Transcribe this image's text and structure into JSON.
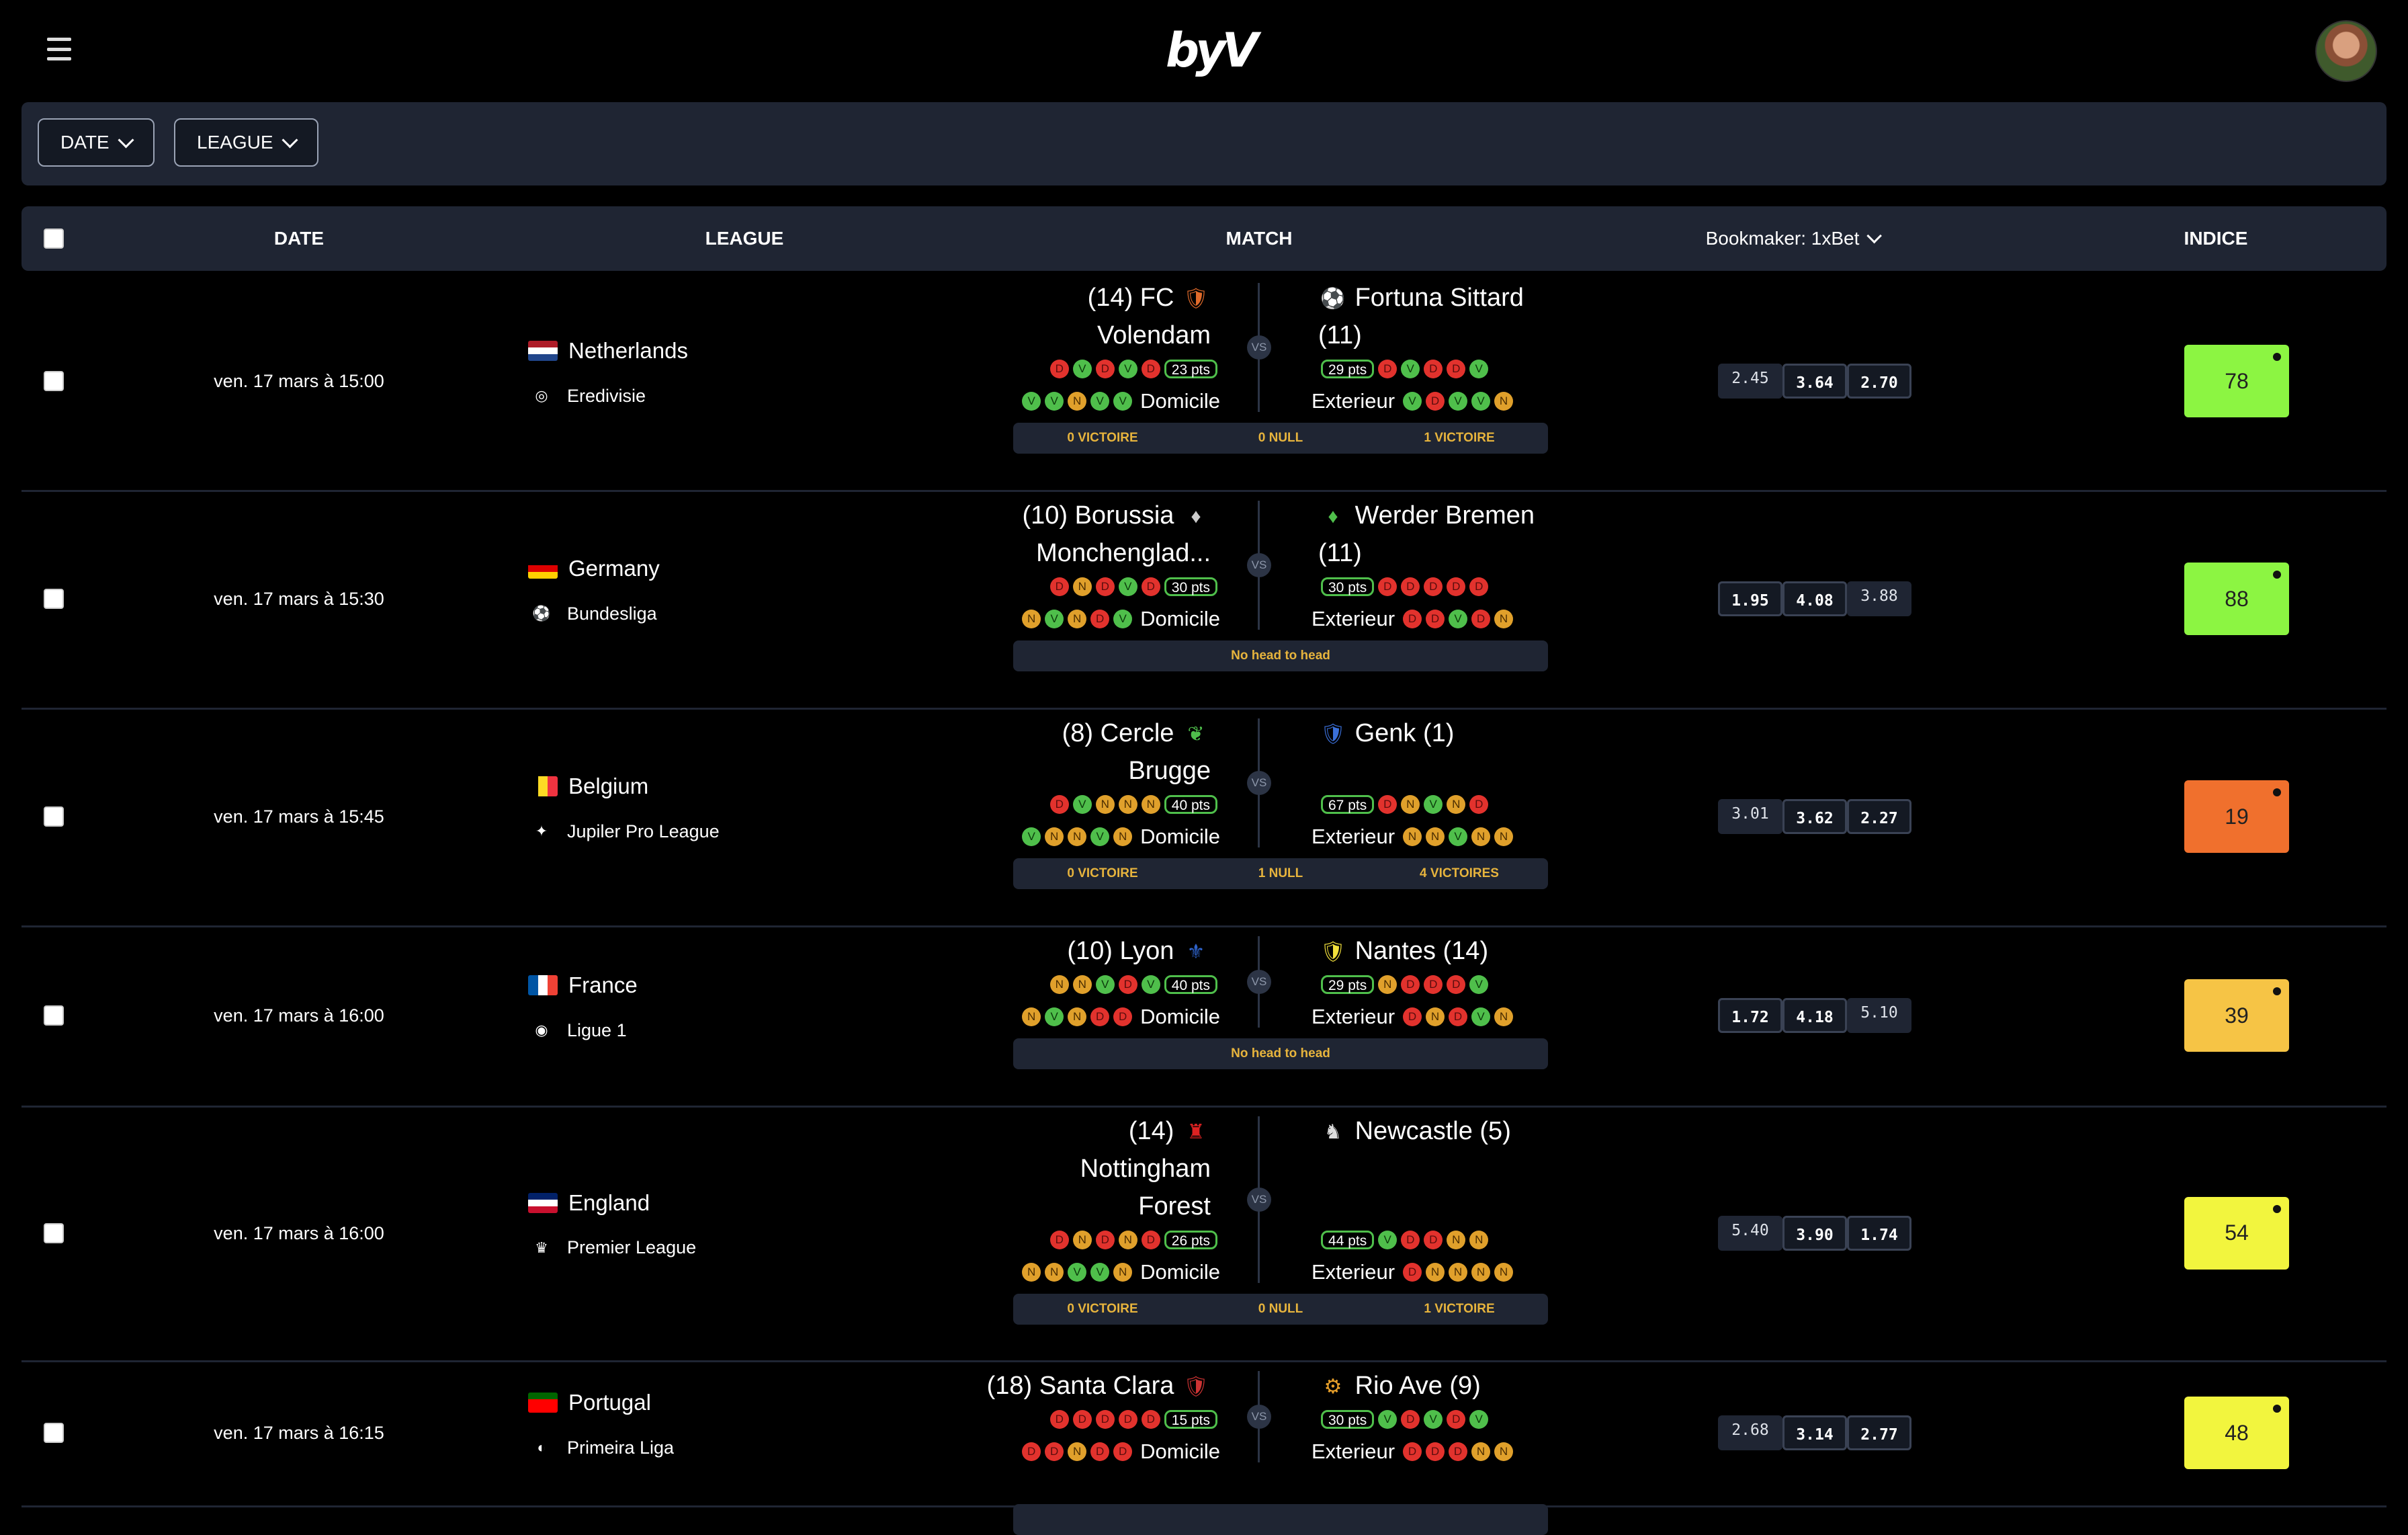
{
  "header": {
    "logo_text": "byV",
    "menu_icon": "hamburger-menu-icon",
    "avatar": "user-avatar"
  },
  "filters": {
    "date_label": "DATE",
    "league_label": "LEAGUE"
  },
  "table": {
    "headers": {
      "date": "DATE",
      "league": "LEAGUE",
      "match": "MATCH",
      "bookmaker": "Bookmaker: 1xBet",
      "indice": "INDICE"
    },
    "vs_label": "VS",
    "home_label": "Domicile",
    "away_label": "Exterieur",
    "rows": [
      {
        "date": "ven. 17 mars à 15:00",
        "country": "Netherlands",
        "league": "Eredivisie",
        "home_name_1": "(14) FC",
        "home_name_2": "Volendam",
        "home_name_3": "",
        "away_name_1": "Fortuna Sittard",
        "away_name_2": "(11)",
        "home_form_1": [
          "D",
          "V",
          "D",
          "V",
          "D"
        ],
        "home_pts": "23 pts",
        "home_form_2": [
          "V",
          "V",
          "N",
          "V",
          "V"
        ],
        "away_pts": "29 pts",
        "away_form_1": [
          "D",
          "V",
          "D",
          "D",
          "V"
        ],
        "away_form_2": [
          "V",
          "D",
          "V",
          "V",
          "N"
        ],
        "h2h": [
          "0 VICTOIRE",
          "0 NULL",
          "1 VICTOIRE"
        ],
        "odds": [
          "2.45",
          "3.64",
          "2.70"
        ],
        "indice": "78",
        "indice_color": "#8cf542"
      },
      {
        "date": "ven. 17 mars à 15:30",
        "country": "Germany",
        "league": "Bundesliga",
        "home_name_1": "(10) Borussia",
        "home_name_2": "Monchenglad...",
        "home_name_3": "",
        "away_name_1": "Werder Bremen",
        "away_name_2": "(11)",
        "home_form_1": [
          "D",
          "N",
          "D",
          "V",
          "D"
        ],
        "home_pts": "30 pts",
        "home_form_2": [
          "N",
          "V",
          "N",
          "D",
          "V"
        ],
        "away_pts": "30 pts",
        "away_form_1": [
          "D",
          "D",
          "D",
          "D",
          "D"
        ],
        "away_form_2": [
          "D",
          "D",
          "V",
          "D",
          "N"
        ],
        "h2h": [
          "No head to head"
        ],
        "odds": [
          "1.95",
          "4.08",
          "3.88"
        ],
        "indice": "88",
        "indice_color": "#8cf542"
      },
      {
        "date": "ven. 17 mars à 15:45",
        "country": "Belgium",
        "league": "Jupiler Pro League",
        "home_name_1": "(8) Cercle",
        "home_name_2": "Brugge",
        "home_name_3": "",
        "away_name_1": "Genk (1)",
        "away_name_2": "",
        "home_form_1": [
          "D",
          "V",
          "N",
          "N",
          "N"
        ],
        "home_pts": "40 pts",
        "home_form_2": [
          "V",
          "N",
          "N",
          "V",
          "N"
        ],
        "away_pts": "67 pts",
        "away_form_1": [
          "D",
          "N",
          "V",
          "N",
          "D"
        ],
        "away_form_2": [
          "N",
          "N",
          "V",
          "N",
          "N"
        ],
        "h2h": [
          "0 VICTOIRE",
          "1 NULL",
          "4 VICTOIRES"
        ],
        "odds": [
          "3.01",
          "3.62",
          "2.27"
        ],
        "indice": "19",
        "indice_color": "#f0702d"
      },
      {
        "date": "ven. 17 mars à 16:00",
        "country": "France",
        "league": "Ligue 1",
        "home_name_1": "(10) Lyon",
        "home_name_2": "",
        "home_name_3": "",
        "away_name_1": "Nantes (14)",
        "away_name_2": "",
        "home_form_1": [
          "N",
          "N",
          "V",
          "D",
          "V"
        ],
        "home_pts": "40 pts",
        "home_form_2": [
          "N",
          "V",
          "N",
          "D",
          "D"
        ],
        "away_pts": "29 pts",
        "away_form_1": [
          "N",
          "D",
          "D",
          "D",
          "V"
        ],
        "away_form_2": [
          "D",
          "N",
          "D",
          "V",
          "N"
        ],
        "h2h": [
          "No head to head"
        ],
        "odds": [
          "1.72",
          "4.18",
          "5.10"
        ],
        "indice": "39",
        "indice_color": "#f6c445"
      },
      {
        "date": "ven. 17 mars à 16:00",
        "country": "England",
        "league": "Premier League",
        "home_name_1": "(14)",
        "home_name_2": "Nottingham",
        "home_name_3": "Forest",
        "away_name_1": "Newcastle (5)",
        "away_name_2": "",
        "home_form_1": [
          "D",
          "N",
          "D",
          "N",
          "D"
        ],
        "home_pts": "26 pts",
        "home_form_2": [
          "N",
          "N",
          "V",
          "V",
          "N"
        ],
        "away_pts": "44 pts",
        "away_form_1": [
          "V",
          "D",
          "D",
          "N",
          "N"
        ],
        "away_form_2": [
          "D",
          "N",
          "N",
          "N",
          "N"
        ],
        "h2h": [
          "0 VICTOIRE",
          "0 NULL",
          "1 VICTOIRE"
        ],
        "odds": [
          "5.40",
          "3.90",
          "1.74"
        ],
        "indice": "54",
        "indice_color": "#f2f53e"
      },
      {
        "date": "ven. 17 mars à 16:15",
        "country": "Portugal",
        "league": "Primeira Liga",
        "home_name_1": "(18) Santa Clara",
        "home_name_2": "",
        "home_name_3": "",
        "away_name_1": "Rio Ave (9)",
        "away_name_2": "",
        "home_form_1": [
          "D",
          "D",
          "D",
          "D",
          "D"
        ],
        "home_pts": "15 pts",
        "home_form_2": [
          "D",
          "D",
          "N",
          "D",
          "D"
        ],
        "away_pts": "30 pts",
        "away_form_1": [
          "V",
          "D",
          "V",
          "D",
          "V"
        ],
        "away_form_2": [
          "D",
          "D",
          "D",
          "N",
          "N"
        ],
        "h2h": [],
        "odds": [
          "2.68",
          "3.14",
          "2.77"
        ],
        "indice": "48",
        "indice_color": "#f2f53e"
      }
    ]
  }
}
